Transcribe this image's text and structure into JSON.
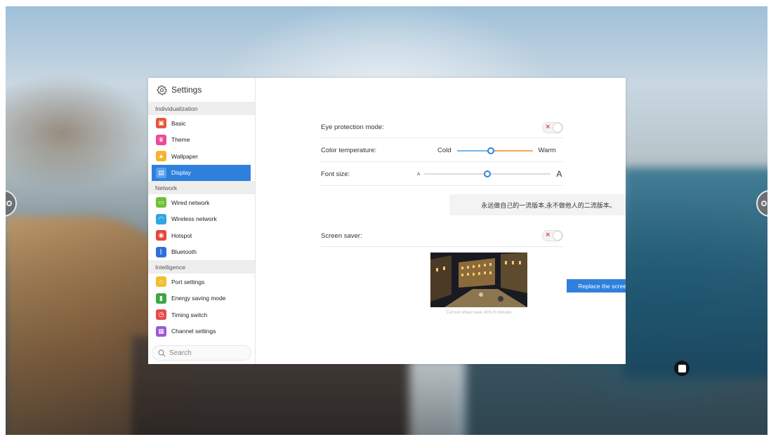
{
  "sidebar": {
    "title": "Settings",
    "sections": [
      {
        "name": "Individualization",
        "items": [
          {
            "label": "Basic",
            "icon": "basic-icon",
            "color": "#e8553a"
          },
          {
            "label": "Theme",
            "icon": "theme-icon",
            "color": "#e84c9a"
          },
          {
            "label": "Wallpaper",
            "icon": "wallpaper-icon",
            "color": "#f5b52e"
          },
          {
            "label": "Display",
            "icon": "display-icon",
            "color": "#2f80dc",
            "active": true
          }
        ]
      },
      {
        "name": "Network",
        "items": [
          {
            "label": "Wired network",
            "icon": "wired-network-icon",
            "color": "#6fbf3a"
          },
          {
            "label": "Wireless network",
            "icon": "wifi-icon",
            "color": "#2fa7e0"
          },
          {
            "label": "Hotspot",
            "icon": "hotspot-icon",
            "color": "#e8453a"
          },
          {
            "label": "Bluetooth",
            "icon": "bluetooth-icon",
            "color": "#2f6fdc"
          }
        ]
      },
      {
        "name": "Intelligence",
        "items": [
          {
            "label": "Port settings",
            "icon": "port-settings-icon",
            "color": "#f2bf2e"
          },
          {
            "label": "Energy saving mode",
            "icon": "energy-saving-icon",
            "color": "#3aa845"
          },
          {
            "label": "Timing switch",
            "icon": "timing-switch-icon",
            "color": "#e84b4b"
          },
          {
            "label": "Channel settings",
            "icon": "channel-settings-icon",
            "color": "#9b59d6"
          }
        ]
      }
    ],
    "search_placeholder": "Search"
  },
  "display": {
    "eye_protection": {
      "label": "Eye protection mode:",
      "enabled": false
    },
    "color_temperature": {
      "label": "Color temperature:",
      "min_label": "Cold",
      "max_label": "Warm",
      "value": 0.45
    },
    "font_size": {
      "label": "Font size:",
      "min_label": "A",
      "max_label": "A",
      "value": 0.5
    },
    "preview_text": "永远做自己的一流版本,永不做他人的二流版本。",
    "screen_saver": {
      "label": "Screen saver:",
      "enabled": false
    },
    "replace_button_label": "Replace the screen protector",
    "screen_saver_caption": "Current wheel save 40% 8 minutes"
  },
  "colors": {
    "accent": "#2f80dc",
    "warm": "#f3a85a",
    "toggle_off": "#e84b4b"
  }
}
